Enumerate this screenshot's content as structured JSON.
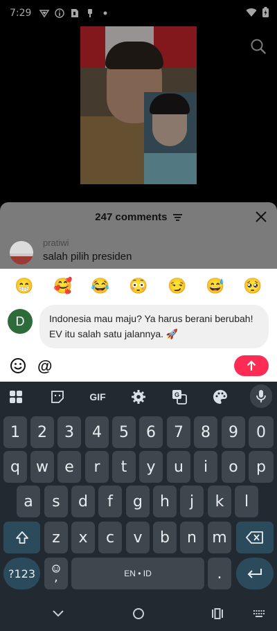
{
  "status": {
    "time": "7:29",
    "icons": [
      "vpn-icon",
      "info-icon",
      "sim-icon",
      "usb-icon",
      "dot-icon"
    ],
    "right_icons": [
      "wifi-icon",
      "battery-icon"
    ]
  },
  "video": {
    "top_icon": "search-icon"
  },
  "comments": {
    "title": "247 comments",
    "items": [
      {
        "user": "pratiwi",
        "text": "salah pilih presiden"
      }
    ]
  },
  "emojis": [
    "😁",
    "🥰",
    "😂",
    "😳",
    "😏",
    "😅",
    "🥺"
  ],
  "composer": {
    "avatar_letter": "D",
    "text": "Indonesia mau maju? Ya harus berani berubah! EV itu salah satu jalannya. 🚀",
    "at_label": "@",
    "accent_color": "#fe2c55"
  },
  "keyboard": {
    "toolbar": [
      "apps-icon",
      "sticker-icon",
      "GIF",
      "settings-icon",
      "translate-icon",
      "palette-icon",
      "mic-icon"
    ],
    "gif_label": "GIF",
    "row_numbers": [
      "1",
      "2",
      "3",
      "4",
      "5",
      "6",
      "7",
      "8",
      "9",
      "0"
    ],
    "row1": [
      "q",
      "w",
      "e",
      "r",
      "t",
      "y",
      "u",
      "i",
      "o",
      "p"
    ],
    "row2": [
      "a",
      "s",
      "d",
      "f",
      "g",
      "h",
      "j",
      "k",
      "l"
    ],
    "row3": [
      "z",
      "x",
      "c",
      "v",
      "b",
      "n",
      "m"
    ],
    "symbols_label": "?123",
    "comma_label": ",",
    "space_label": "EN • ID",
    "period_label": "."
  },
  "navbar": {
    "icons": [
      "back-icon",
      "home-icon",
      "recents-icon",
      "keyboard-switch-icon"
    ]
  }
}
